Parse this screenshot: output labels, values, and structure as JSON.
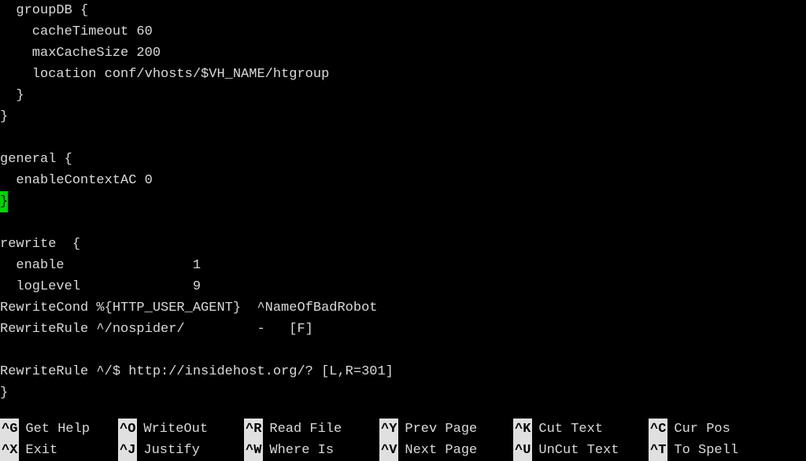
{
  "editor": {
    "lines": [
      "  groupDB {",
      "    cacheTimeout 60",
      "    maxCacheSize 200",
      "    location conf/vhosts/$VH_NAME/htgroup",
      "  }",
      "}",
      "",
      "general {",
      "  enableContextAC 0"
    ],
    "cursor_line_char": "}",
    "lines_after": [
      "",
      "rewrite  {",
      "  enable                1",
      "  logLevel              9",
      "RewriteCond %{HTTP_USER_AGENT}  ^NameOfBadRobot",
      "RewriteRule ^/nospider/         -   [F]",
      "",
      "RewriteRule ^/$ http://insidehost.org/? [L,R=301]",
      "}"
    ]
  },
  "shortcuts": {
    "row1": [
      {
        "key": "^G",
        "label": "Get Help"
      },
      {
        "key": "^O",
        "label": "WriteOut"
      },
      {
        "key": "^R",
        "label": "Read File"
      },
      {
        "key": "^Y",
        "label": "Prev Page"
      },
      {
        "key": "^K",
        "label": "Cut Text"
      },
      {
        "key": "^C",
        "label": "Cur Pos"
      }
    ],
    "row2": [
      {
        "key": "^X",
        "label": "Exit"
      },
      {
        "key": "^J",
        "label": "Justify"
      },
      {
        "key": "^W",
        "label": "Where Is"
      },
      {
        "key": "^V",
        "label": "Next Page"
      },
      {
        "key": "^U",
        "label": "UnCut Text"
      },
      {
        "key": "^T",
        "label": "To Spell"
      }
    ]
  }
}
